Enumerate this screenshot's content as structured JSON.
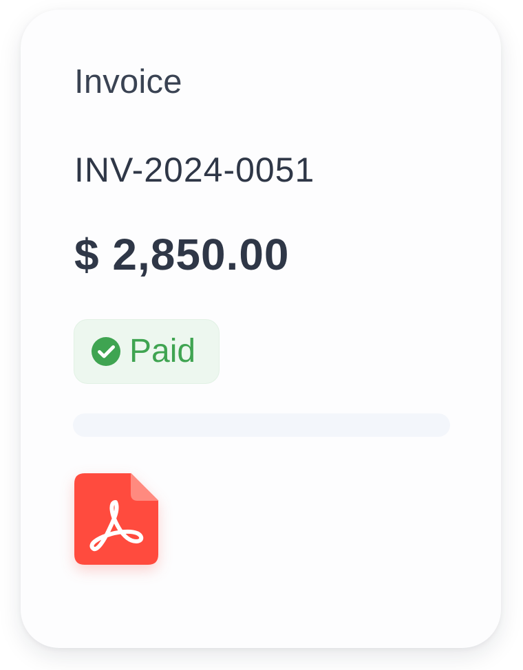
{
  "invoice_card": {
    "title": "Invoice",
    "invoice_number": "INV-2024-0051",
    "amount": "$ 2,850.00",
    "status": {
      "label": "Paid",
      "icon": "check-circle-icon",
      "color": "#3fa451",
      "background": "#edf7ef"
    },
    "attachment": {
      "icon": "pdf-file-icon",
      "color": "#ff4b3e"
    }
  }
}
